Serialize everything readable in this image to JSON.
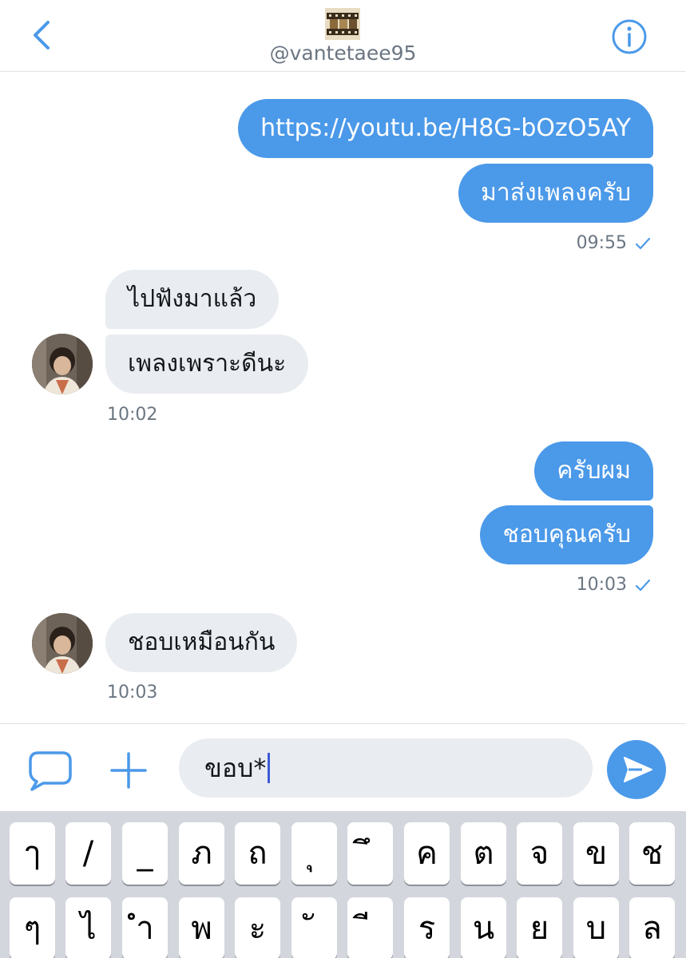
{
  "header": {
    "handle": "@vantetaee95",
    "back_icon": "chevron-left-icon",
    "info_icon": "info-circle-icon"
  },
  "messages": [
    {
      "dir": "out",
      "text": "https://youtu.be/H8G-bOzO5AY"
    },
    {
      "dir": "out",
      "text": "มาส่งเพลงครับ"
    },
    {
      "dir": "out-ts",
      "text": "09:55"
    },
    {
      "dir": "in",
      "text": "ไปฟังมาแล้ว"
    },
    {
      "dir": "in",
      "text": "เพลงเพราะดีนะ"
    },
    {
      "dir": "in-ts",
      "text": "10:02"
    },
    {
      "dir": "out",
      "text": "ครับผม"
    },
    {
      "dir": "out",
      "text": "ชอบคุณครับ"
    },
    {
      "dir": "out-ts",
      "text": "10:03"
    },
    {
      "dir": "in",
      "text": "ชอบเหมือนกัน"
    },
    {
      "dir": "in-ts",
      "text": "10:03"
    }
  ],
  "composer": {
    "value": "ขอบ*",
    "gif_icon": "speech-bubble-icon",
    "add_icon": "plus-icon",
    "send_icon": "send-icon"
  },
  "keyboard": {
    "row1": [
      "ๅ",
      "/",
      "_",
      "ภ",
      "ถ",
      "ุ",
      "ึ",
      "ค",
      "ต",
      "จ",
      "ข",
      "ช"
    ],
    "row2": [
      "ๆ",
      "ไ",
      "ำ",
      "พ",
      "ะ",
      "ั",
      "ี",
      "ร",
      "น",
      "ย",
      "บ",
      "ล"
    ]
  },
  "colors": {
    "accent": "#4b99e9",
    "incoming_bubble": "#e9ecf0",
    "timestamp": "#6b7682",
    "keyboard_bg": "#d3d6dc"
  }
}
